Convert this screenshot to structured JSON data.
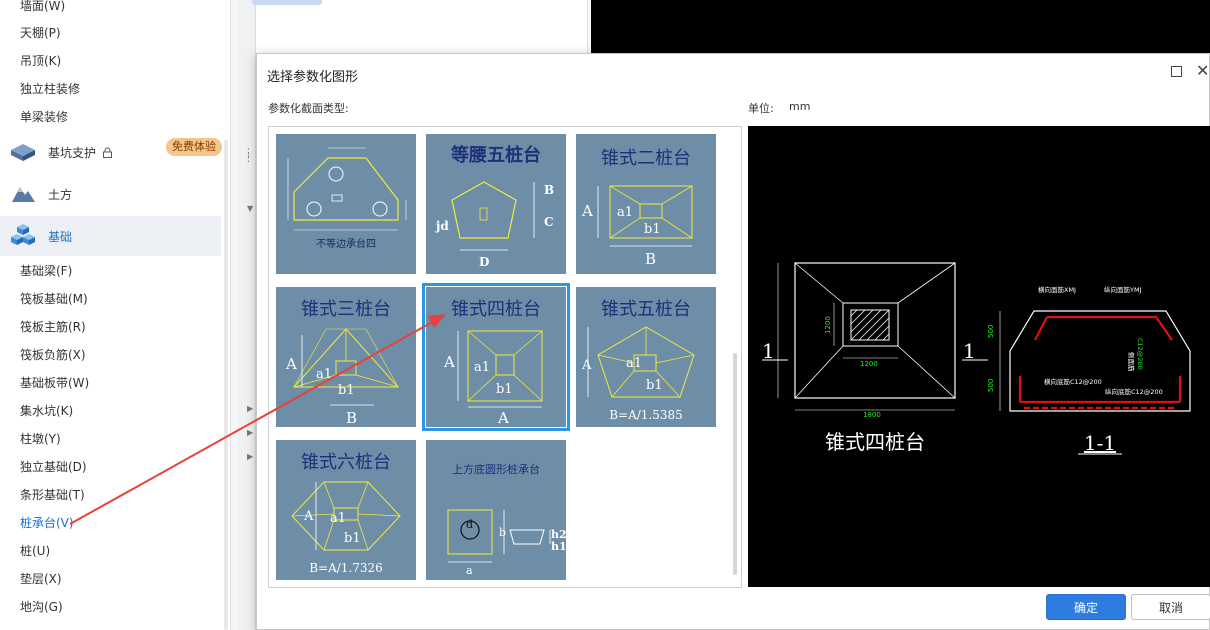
{
  "sidebar": {
    "top_items": [
      "墙面(W)",
      "天棚(P)",
      "吊顶(K)",
      "独立柱装修",
      "单梁装修"
    ],
    "groups": [
      {
        "label": "基坑支护",
        "badge": "免费体验"
      },
      {
        "label": "土方"
      },
      {
        "label": "基础"
      }
    ],
    "items": [
      "基础梁(F)",
      "筏板基础(M)",
      "筏板主筋(R)",
      "筏板负筋(X)",
      "基础板带(W)",
      "集水坑(K)",
      "柱墩(Y)",
      "独立基础(D)",
      "条形基础(T)",
      "桩承台(V)",
      "桩(U)",
      "垫层(X)",
      "地沟(G)"
    ],
    "active_item": "桩承台(V)",
    "colors": {
      "active": "#1a6fd1",
      "badge_bg": "#f7c58a"
    }
  },
  "dialog": {
    "title": "选择参数化图形",
    "section_label": "参数化截面类型:",
    "unit_label": "单位:",
    "unit_value": "mm",
    "ok_label": "确定",
    "cancel_label": "取消",
    "tiles": [
      {
        "caption": "不等边承台四",
        "labels": []
      },
      {
        "title": "等腰五桩台",
        "labels": [
          "B",
          "C",
          "jd",
          "D"
        ]
      },
      {
        "title": "锥式二桩台",
        "labels": [
          "A",
          "a1",
          "b1",
          "B"
        ]
      },
      {
        "title": "锥式三桩台",
        "labels": [
          "A",
          "a1",
          "b1",
          "B"
        ]
      },
      {
        "title": "锥式四桩台",
        "labels": [
          "A",
          "a1",
          "b1",
          "A"
        ]
      },
      {
        "title": "锥式五桩台",
        "labels": [
          "A",
          "a1",
          "b1"
        ],
        "formula": "B=A/1.5385"
      },
      {
        "title": "锥式六桩台",
        "labels": [
          "A",
          "a1",
          "b1"
        ],
        "formula": "B=A/1.7326"
      },
      {
        "title": "上方底圆形桩承台",
        "labels": [
          "d",
          "b",
          "h2",
          "h1",
          "a"
        ]
      }
    ],
    "selected_tile": "锥式四桩台",
    "preview": {
      "plan_label": "锥式四桩台",
      "section_label": "1-1",
      "cut_mark": "1",
      "dims": [
        "1200",
        "1200",
        "1800",
        "500",
        "500"
      ],
      "rebar_labels": [
        "横向面筋XMJ",
        "纵向面筋YMJ",
        "侧面筋",
        "C12@200",
        "横向底筋C12@200",
        "纵向底筋C12@200"
      ],
      "colors": {
        "rebar": "#e01010",
        "dim_text": "#22ee22",
        "line": "#ffffff"
      }
    },
    "colors": {
      "tile_bg": "#6e8ea8",
      "tile_title": "#1f2f7a",
      "selected": "#2a97e6",
      "ok": "#2f7ce0"
    }
  }
}
